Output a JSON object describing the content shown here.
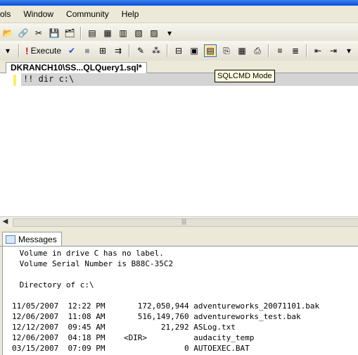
{
  "menu": {
    "items": [
      "ols",
      "Window",
      "Community",
      "Help"
    ]
  },
  "toolbar2": {
    "execute_label": "Execute"
  },
  "tooltip": {
    "text": "SQLCMD Mode"
  },
  "document_tab": {
    "label": "DKRANCH10\\SS...QLQuery1.sql*"
  },
  "editor": {
    "line1": "!! dir c:\\"
  },
  "results": {
    "tab_label": "Messages"
  },
  "messages": {
    "lines": [
      " Volume in drive C has no label.",
      " Volume Serial Number is B88C-35C2",
      "",
      " Directory of c:\\",
      "",
      "11/05/2007  12:22 PM       172,050,944 adventureworks_20071101.bak",
      "12/06/2007  11:08 AM       516,149,760 adventureworks_test.bak",
      "12/12/2007  09:45 AM            21,292 ASLog.txt",
      "12/06/2007  04:18 PM    <DIR>          audacity_temp",
      "03/15/2007  07:09 PM                 0 AUTOEXEC.BAT"
    ]
  }
}
